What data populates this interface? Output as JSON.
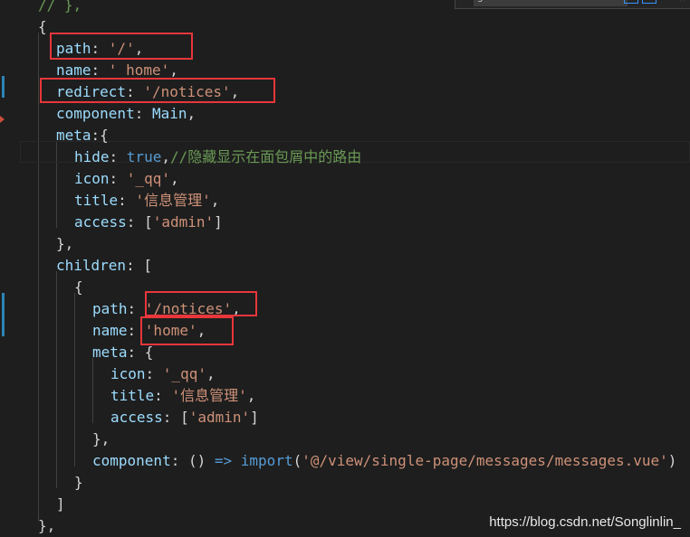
{
  "find_widget": {
    "query": "getBreadcrumbList",
    "close_icon": "close-icon"
  },
  "code_lines": [
    [
      {
        "t": "// },",
        "c": "c"
      }
    ],
    [
      {
        "t": "{",
        "c": "p"
      }
    ],
    [
      {
        "t": "path",
        "c": "k"
      },
      {
        "t": ": ",
        "c": "p"
      },
      {
        "t": "'/'",
        "c": "s"
      },
      {
        "t": ",",
        "c": "p"
      }
    ],
    [
      {
        "t": "name",
        "c": "k"
      },
      {
        "t": ": ",
        "c": "p"
      },
      {
        "t": "'_home'",
        "c": "s"
      },
      {
        "t": ",",
        "c": "p"
      }
    ],
    [
      {
        "t": "redirect",
        "c": "k"
      },
      {
        "t": ": ",
        "c": "p"
      },
      {
        "t": "'/notices'",
        "c": "s"
      },
      {
        "t": ",",
        "c": "p"
      }
    ],
    [
      {
        "t": "component",
        "c": "k"
      },
      {
        "t": ": ",
        "c": "p"
      },
      {
        "t": "Main",
        "c": "k"
      },
      {
        "t": ",",
        "c": "p"
      }
    ],
    [
      {
        "t": "meta",
        "c": "k"
      },
      {
        "t": ":{",
        "c": "p"
      }
    ],
    [
      {
        "t": "hide",
        "c": "k"
      },
      {
        "t": ": ",
        "c": "p"
      },
      {
        "t": "true",
        "c": "b"
      },
      {
        "t": ",",
        "c": "p"
      },
      {
        "t": "//隐藏显示在面包屑中的路由",
        "c": "c"
      }
    ],
    [
      {
        "t": "icon",
        "c": "k"
      },
      {
        "t": ": ",
        "c": "p"
      },
      {
        "t": "'_qq'",
        "c": "s"
      },
      {
        "t": ",",
        "c": "p"
      }
    ],
    [
      {
        "t": "title",
        "c": "k"
      },
      {
        "t": ": ",
        "c": "p"
      },
      {
        "t": "'信息管理'",
        "c": "s"
      },
      {
        "t": ",",
        "c": "p"
      }
    ],
    [
      {
        "t": "access",
        "c": "k"
      },
      {
        "t": ": [",
        "c": "p"
      },
      {
        "t": "'admin'",
        "c": "s"
      },
      {
        "t": "]",
        "c": "p"
      }
    ],
    [
      {
        "t": "},",
        "c": "p"
      }
    ],
    [
      {
        "t": "children",
        "c": "k"
      },
      {
        "t": ": [",
        "c": "p"
      }
    ],
    [
      {
        "t": "{",
        "c": "p"
      }
    ],
    [
      {
        "t": "path",
        "c": "k"
      },
      {
        "t": ": ",
        "c": "p"
      },
      {
        "t": "'/notices'",
        "c": "s"
      },
      {
        "t": ",",
        "c": "p"
      }
    ],
    [
      {
        "t": "name",
        "c": "k"
      },
      {
        "t": ": ",
        "c": "p"
      },
      {
        "t": "'home'",
        "c": "s"
      },
      {
        "t": ",",
        "c": "p"
      }
    ],
    [
      {
        "t": "meta",
        "c": "k"
      },
      {
        "t": ": {",
        "c": "p"
      }
    ],
    [
      {
        "t": "icon",
        "c": "k"
      },
      {
        "t": ": ",
        "c": "p"
      },
      {
        "t": "'_qq'",
        "c": "s"
      },
      {
        "t": ",",
        "c": "p"
      }
    ],
    [
      {
        "t": "title",
        "c": "k"
      },
      {
        "t": ": ",
        "c": "p"
      },
      {
        "t": "'信息管理'",
        "c": "s"
      },
      {
        "t": ",",
        "c": "p"
      }
    ],
    [
      {
        "t": "access",
        "c": "k"
      },
      {
        "t": ": [",
        "c": "p"
      },
      {
        "t": "'admin'",
        "c": "s"
      },
      {
        "t": "]",
        "c": "p"
      }
    ],
    [
      {
        "t": "},",
        "c": "p"
      }
    ],
    [
      {
        "t": "component",
        "c": "k"
      },
      {
        "t": ": () ",
        "c": "p"
      },
      {
        "t": "=>",
        "c": "b"
      },
      {
        "t": " ",
        "c": "p"
      },
      {
        "t": "import",
        "c": "imp"
      },
      {
        "t": "(",
        "c": "p"
      },
      {
        "t": "'@/view/single-page/messages/messages.vue'",
        "c": "s"
      },
      {
        "t": ")",
        "c": "p"
      }
    ],
    [
      {
        "t": "}",
        "c": "p"
      }
    ],
    [
      {
        "t": "]",
        "c": "p"
      }
    ],
    [
      {
        "t": "},",
        "c": "p"
      }
    ]
  ],
  "watermark": "https://blog.csdn.net/Songlinlin_"
}
